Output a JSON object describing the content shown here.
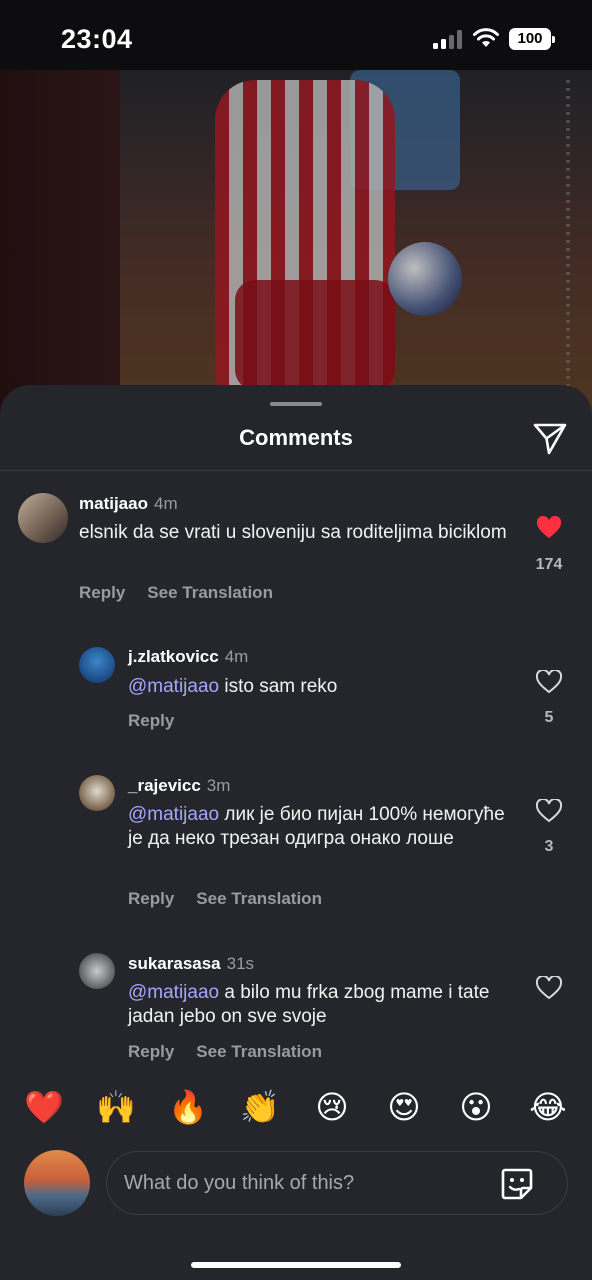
{
  "status": {
    "time": "23:04",
    "battery": "100"
  },
  "header": {
    "title": "Comments"
  },
  "comments": [
    {
      "username": "matijaao",
      "time": "4m",
      "text": "elsnik da se vrati u sloveniju sa roditeljima biciklom",
      "likes": "174",
      "liked": true,
      "reply": "Reply",
      "see_translation": "See Translation"
    },
    {
      "username": "j.zlatkovicc",
      "time": "4m",
      "mention": "@matijaao",
      "text": "isto sam reko",
      "likes": "5",
      "liked": false,
      "reply": "Reply"
    },
    {
      "username": "_rajevicc",
      "time": "3m",
      "mention": "@matijaao",
      "text": "лик је био пијан 100% немогуће је да неко трезан одигра онако лоше",
      "likes": "3",
      "liked": false,
      "reply": "Reply",
      "see_translation": "See Translation"
    },
    {
      "username": "sukarasasa",
      "time": "31s",
      "mention": "@matijaao",
      "text": "a bilo mu frka zbog mame i tate jadan jebo on sve svoje",
      "liked": false,
      "reply": "Reply",
      "see_translation": "See Translation"
    }
  ],
  "emoji_bar": [
    "❤️",
    "🙌",
    "🔥",
    "👏",
    "😢",
    "😍",
    "😮",
    "😂"
  ],
  "composer": {
    "placeholder": "What do you think of this?"
  },
  "colors": {
    "sheet": "#25262b",
    "mention": "#a7a6ff",
    "heart": "#ff3040"
  },
  "icons": [
    "share-icon",
    "heart-icon",
    "sticker-icon",
    "wifi-icon",
    "signal-icon"
  ]
}
